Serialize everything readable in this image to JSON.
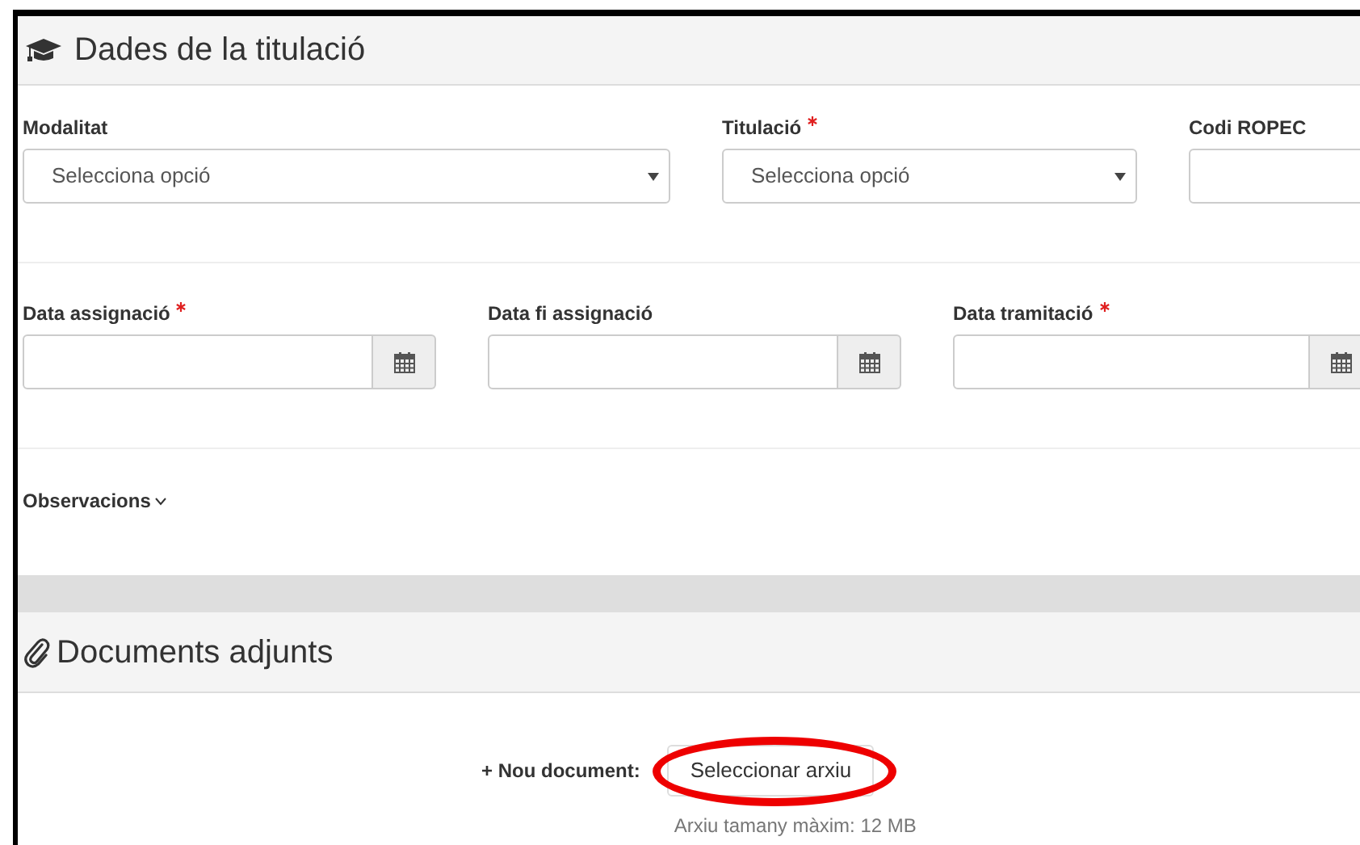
{
  "sections": [
    {
      "kind": "form",
      "title": "Dades de la titulació",
      "rows": [
        {
          "fields": [
            {
              "kind": "select",
              "label": "Modalitat",
              "required": false,
              "placeholder": "Selecciona opció"
            },
            {
              "kind": "select",
              "label": "Titulació",
              "required": true,
              "placeholder": "Selecciona opció"
            },
            {
              "kind": "text",
              "label": "Codi ROPEC",
              "required": false
            }
          ]
        },
        {
          "fields": [
            {
              "kind": "date",
              "label": "Data assignació",
              "required": true
            },
            {
              "kind": "date",
              "label": "Data fi assignació",
              "required": false
            },
            {
              "kind": "date",
              "label": "Data tramitació",
              "required": true
            }
          ]
        }
      ],
      "collapsible": {
        "label": "Observacions",
        "expanded": false
      }
    },
    {
      "kind": "upload",
      "title": "Documents adjunts",
      "upload_label": "+ Nou document:",
      "button": {
        "label": "Seleccionar arxiu",
        "annotated": true
      },
      "hint": "Arxiu tamany màxim: 12 MB"
    }
  ]
}
